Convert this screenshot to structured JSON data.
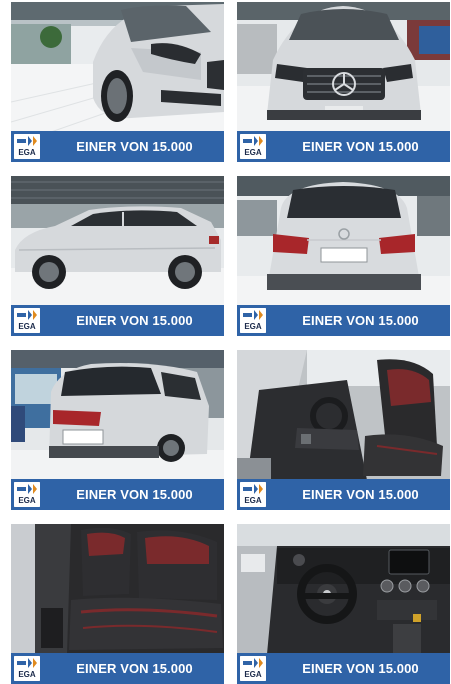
{
  "gallery": {
    "tiles": [
      {
        "banner": "EINER VON 15.000",
        "logo": "EGA",
        "photo": "front-left-car-photo"
      },
      {
        "banner": "EINER VON 15.000",
        "logo": "EGA",
        "photo": "front-car-photo"
      },
      {
        "banner": "EINER VON 15.000",
        "logo": "EGA",
        "photo": "side-car-photo"
      },
      {
        "banner": "EINER VON 15.000",
        "logo": "EGA",
        "photo": "rear-car-photo"
      },
      {
        "banner": "EINER VON 15.000",
        "logo": "EGA",
        "photo": "rear-left-car-photo"
      },
      {
        "banner": "EINER VON 15.000",
        "logo": "EGA",
        "photo": "front-seats-photo"
      },
      {
        "banner": "EINER VON 15.000",
        "logo": "EGA",
        "photo": "rear-seats-photo"
      },
      {
        "banner": "EINER VON 15.000",
        "logo": "EGA",
        "photo": "dashboard-photo"
      }
    ]
  },
  "colors": {
    "banner": "#2f63a7",
    "banner_text": "#ffffff",
    "car_silver": "#d6d9dc",
    "interior_dark": "#2a2a2c",
    "seat_red": "#7a2a2c"
  }
}
